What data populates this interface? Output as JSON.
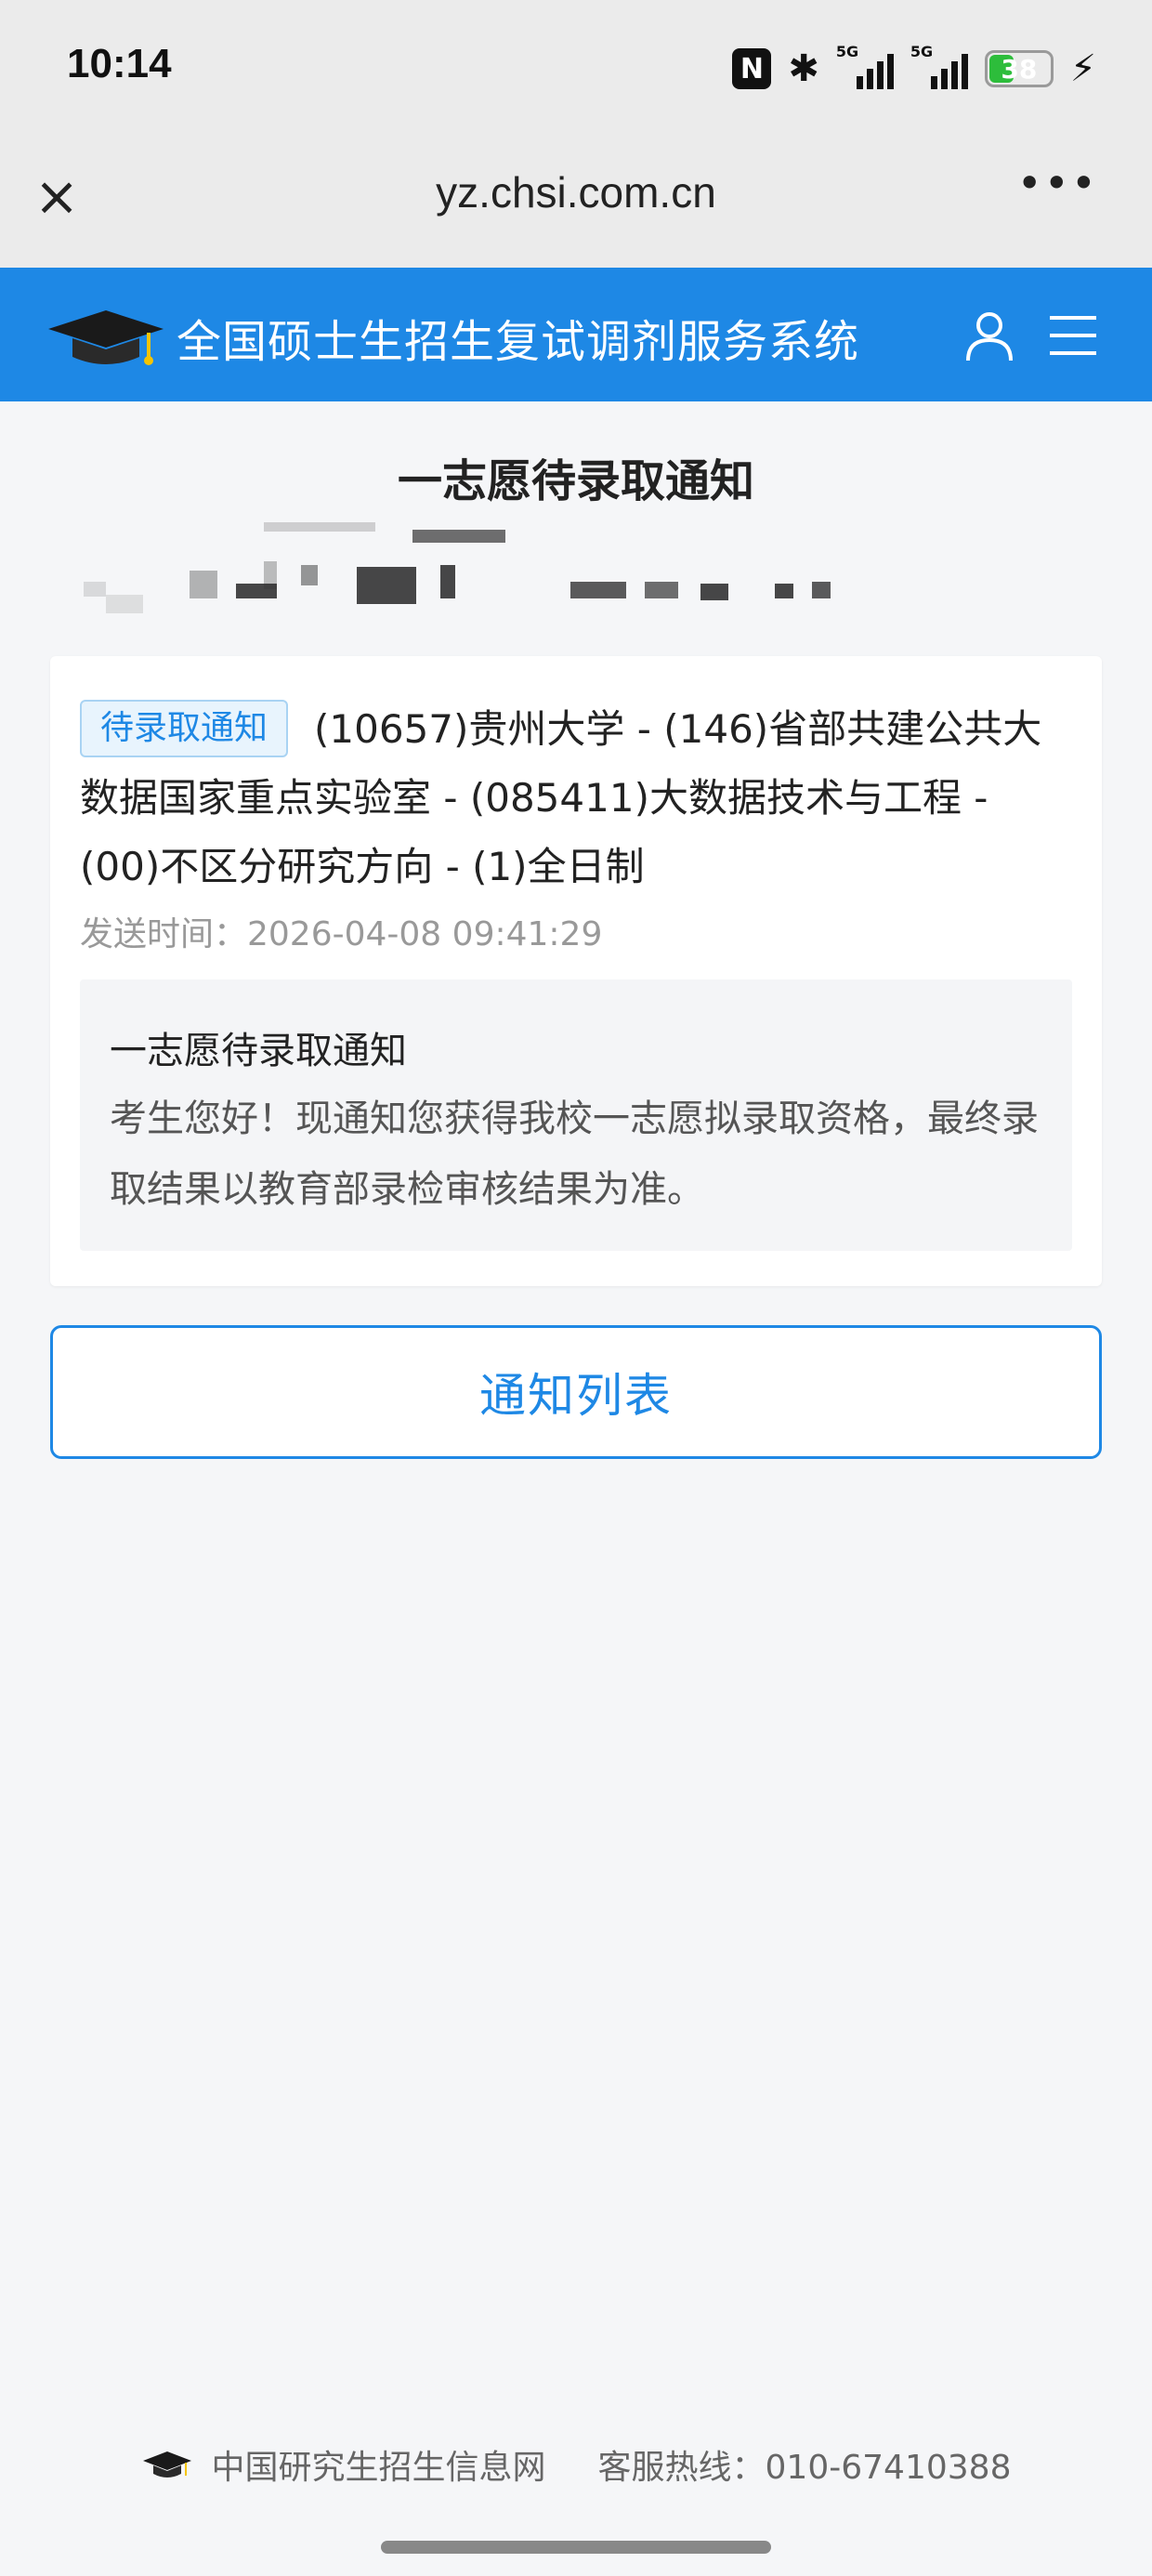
{
  "status_bar": {
    "time": "10:14",
    "battery_level": "38",
    "network_labels": [
      "5G",
      "5G"
    ],
    "icons": [
      "nfc-icon",
      "bluetooth-icon",
      "signal-icon",
      "signal-icon",
      "battery-icon",
      "charging-icon"
    ]
  },
  "browser": {
    "url": "yz.chsi.com.cn",
    "close_icon": "close-icon",
    "more_icon": "more-icon",
    "more_glyph": "•••"
  },
  "header": {
    "title": "全国硕士生招生复试调剂服务系统",
    "logo": "graduation-cap-logo",
    "icons": [
      "user-icon",
      "menu-icon"
    ],
    "color": "#1e88e5"
  },
  "page": {
    "title": "一志愿待录取通知"
  },
  "notice_card": {
    "badge": "待录取通知",
    "program": "(10657)贵州大学 - (146)省部共建公共大数据国家重点实验室 - (085411)大数据技术与工程 - (00)不区分研究方向 - (1)全日制",
    "send_time": "发送时间：2026-04-08 09:41:29",
    "message_title": "一志愿待录取通知",
    "message_body": "考生您好！现通知您获得我校一志愿拟录取资格，最终录取结果以教育部录检审核结果为准。"
  },
  "list_button": {
    "label": "通知列表"
  },
  "footer": {
    "site_name": "中国研究生招生信息网",
    "hotline": "客服热线：010-67410388"
  }
}
